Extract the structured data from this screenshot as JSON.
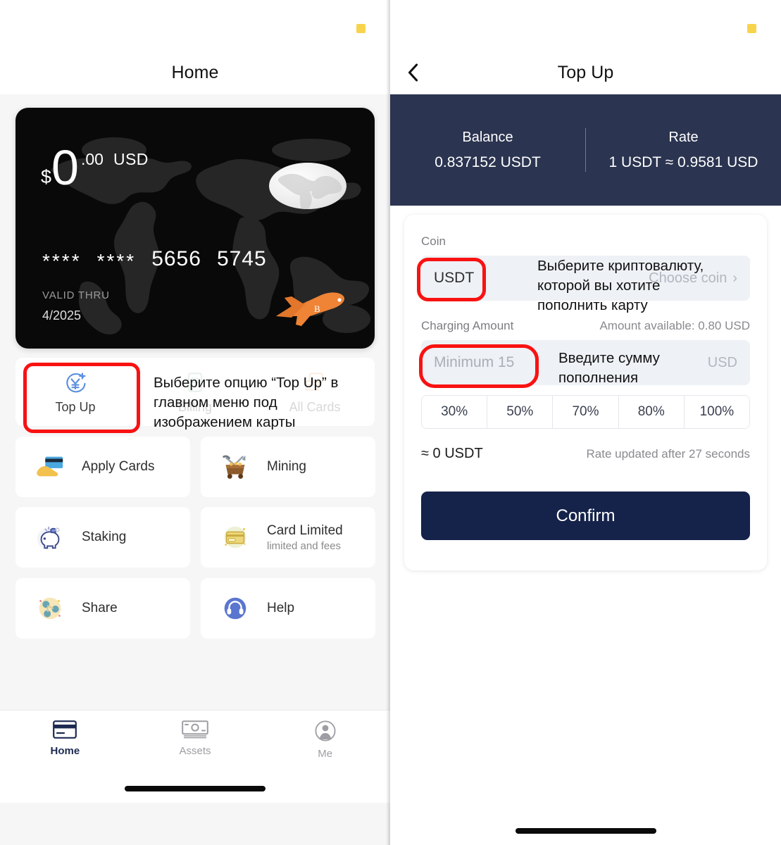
{
  "left": {
    "nav_title": "Home",
    "card": {
      "currency_sign": "$",
      "amount_int": "0",
      "amount_dec": ".00",
      "amount_currency": "USD",
      "masked_group_1": "****",
      "masked_group_2": "****",
      "number_group_3": "5656",
      "number_group_4": "5745",
      "valid_thru_label": "VALID THRU",
      "valid_thru_value": "4/2025"
    },
    "quick_row": [
      {
        "label": "Top Up",
        "icon": "top-up-icon"
      },
      {
        "label": "Billing",
        "icon": "billing-icon"
      },
      {
        "label": "All Cards",
        "icon": "all-cards-icon"
      }
    ],
    "grid": [
      {
        "title": "Apply Cards",
        "subtitle": "",
        "icon": "apply-cards-icon"
      },
      {
        "title": "Mining",
        "subtitle": "",
        "icon": "mining-icon"
      },
      {
        "title": "Staking",
        "subtitle": "",
        "icon": "staking-icon"
      },
      {
        "title": "Card Limited",
        "subtitle": "limited and fees",
        "icon": "card-limited-icon"
      },
      {
        "title": "Share",
        "subtitle": "",
        "icon": "share-icon"
      },
      {
        "title": "Help",
        "subtitle": "",
        "icon": "help-icon"
      }
    ],
    "tabs": [
      {
        "label": "Home",
        "icon": "card-icon",
        "active": true
      },
      {
        "label": "Assets",
        "icon": "banknote-icon",
        "active": false
      },
      {
        "label": "Me",
        "icon": "person-icon",
        "active": false
      }
    ]
  },
  "right": {
    "nav_title": "Top Up",
    "back_icon": "chevron-left-icon",
    "balance": {
      "balance_label": "Balance",
      "balance_value": "0.837152 USDT",
      "rate_label": "Rate",
      "rate_value": "1 USDT ≈ 0.9581 USD"
    },
    "form": {
      "coin_label": "Coin",
      "coin_value": "USDT",
      "coin_placeholder": "Choose coin",
      "coin_chevron": "›",
      "amount_label": "Charging Amount",
      "amount_available": "Amount available: 0.80 USD",
      "amount_placeholder": "Minimum 15",
      "amount_unit": "USD",
      "percentages": [
        "30%",
        "50%",
        "70%",
        "80%",
        "100%"
      ],
      "converted": "≈ 0 USDT",
      "rate_timer": "Rate updated after 27 seconds",
      "confirm_label": "Confirm"
    }
  },
  "annotations": {
    "note_1": "Выберите опцию “Top Up” в главном меню под изображением карты",
    "note_2": "Выберите криптовалюту, которой вы хотите пополнить карту",
    "note_3": "Введите сумму пополнения",
    "highlight_color": "#f91212"
  },
  "colors": {
    "navy": "#2b3450",
    "confirm_navy": "#15224a",
    "status_marker": "#f7d44c",
    "card_black": "#090909",
    "page_bg": "#f6f6f7"
  }
}
